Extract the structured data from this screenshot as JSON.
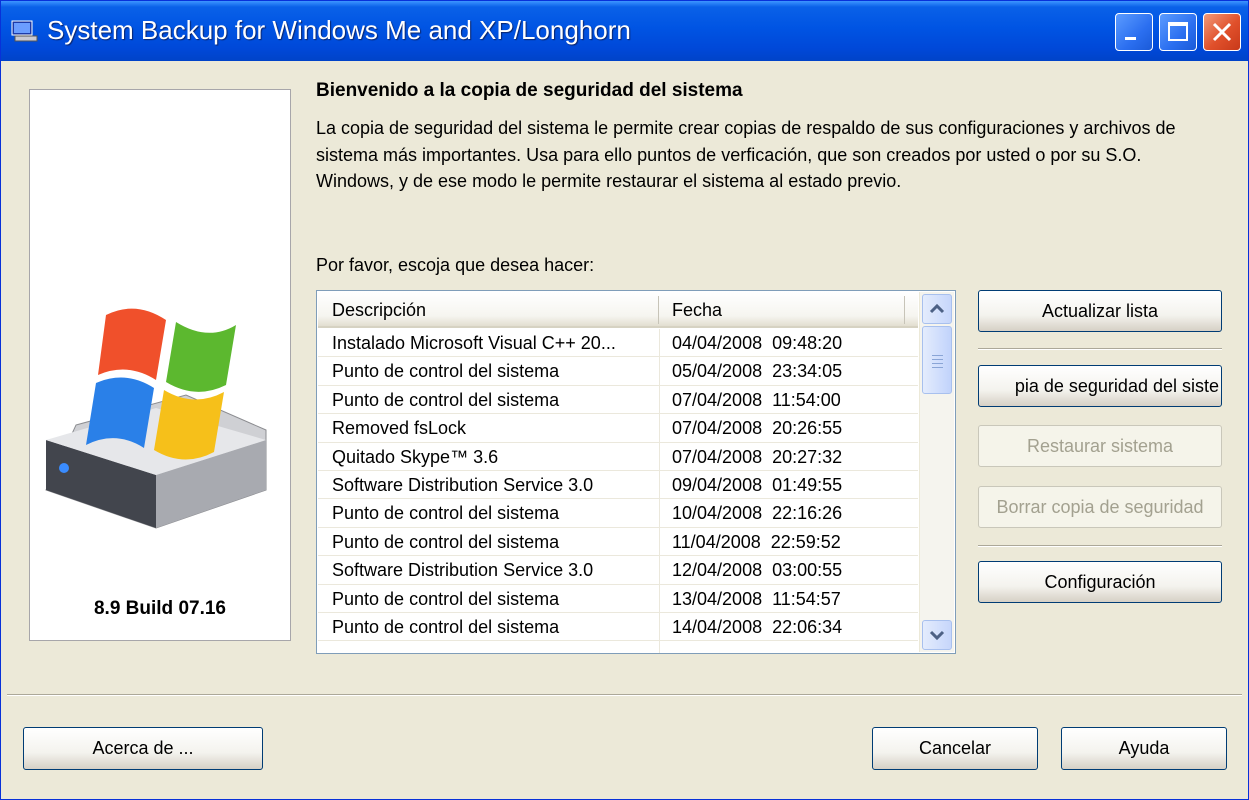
{
  "window": {
    "title": "System Backup for Windows Me and XP/Longhorn"
  },
  "sidebar": {
    "version": "8.9 Build 07.16"
  },
  "main": {
    "heading": "Bienvenido a la copia de seguridad del sistema",
    "description": "La copia de seguridad del sistema le permite crear copias de respaldo de sus configuraciones y archivos de sistema más importantes. Usa para ello puntos de verficación, que son creados por usted o por su S.O. Windows, y de ese modo le permite restaurar el sistema al estado previo.",
    "prompt": "Por favor, escoja que desea hacer:"
  },
  "list": {
    "columns": [
      "Descripción",
      "Fecha"
    ],
    "rows": [
      [
        "Instalado Microsoft Visual C++ 20...",
        "04/04/2008  09:48:20"
      ],
      [
        "Punto de control del sistema",
        "05/04/2008  23:34:05"
      ],
      [
        "Punto de control del sistema",
        "07/04/2008  11:54:00"
      ],
      [
        "Removed fsLock",
        "07/04/2008  20:26:55"
      ],
      [
        "Quitado Skype™ 3.6",
        "07/04/2008  20:27:32"
      ],
      [
        "Software Distribution Service 3.0",
        "09/04/2008  01:49:55"
      ],
      [
        "Punto de control del sistema",
        "10/04/2008  22:16:26"
      ],
      [
        "Punto de control del sistema",
        "11/04/2008  22:59:52"
      ],
      [
        "Software Distribution Service 3.0",
        "12/04/2008  03:00:55"
      ],
      [
        "Punto de control del sistema",
        "13/04/2008  11:54:57"
      ],
      [
        "Punto de control del sistema",
        "14/04/2008  22:06:34"
      ]
    ]
  },
  "actions": {
    "refresh": "Actualizar lista",
    "backup": "pia de seguridad del siste",
    "restore": "Restaurar sistema",
    "delete": "Borrar copia de seguridad",
    "config": "Configuración"
  },
  "footer": {
    "about": "Acerca de ...",
    "cancel": "Cancelar",
    "help": "Ayuda"
  }
}
